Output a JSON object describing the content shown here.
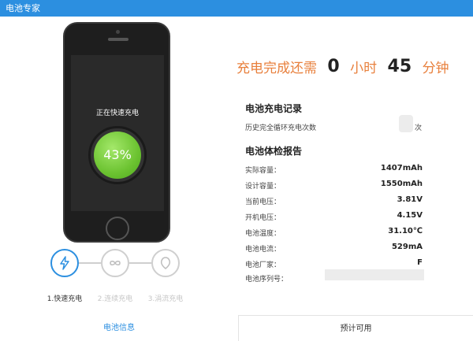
{
  "window": {
    "title": "电池专家"
  },
  "phone": {
    "charging_label": "正在快速充电",
    "battery_percent": "43%",
    "battery_level": 0.43
  },
  "modes": [
    {
      "label": "1.快速充电",
      "icon": "lightning-icon",
      "active": true
    },
    {
      "label": "2.连续充电",
      "icon": "infinity-icon",
      "active": false
    },
    {
      "label": "3.涓流充电",
      "icon": "droplet-icon",
      "active": false
    }
  ],
  "eta": {
    "prefix": "充电完成还需",
    "hours": "0",
    "hours_unit": "小时",
    "minutes": "45",
    "minutes_unit": "分钟"
  },
  "record": {
    "title": "电池充电记录",
    "cycle_label": "历史完全循环充电次数",
    "cycle_suffix": "次"
  },
  "report": {
    "title": "电池体检报告",
    "rows": [
      {
        "label": "实际容量：",
        "value": "1407mAh"
      },
      {
        "label": "设计容量：",
        "value": "1550mAh"
      },
      {
        "label": "当前电压：",
        "value": "3.81V"
      },
      {
        "label": "开机电压：",
        "value": "4.15V"
      },
      {
        "label": "电池温度：",
        "value": "31.10℃"
      },
      {
        "label": "电池电流：",
        "value": "529mA"
      },
      {
        "label": "电池厂家：",
        "value": "F"
      },
      {
        "label": "电池序列号：",
        "value": ""
      }
    ]
  },
  "footer": {
    "left": "电池信息",
    "right": "预计可用"
  },
  "colors": {
    "accent": "#2c8fe0",
    "eta": "#e8803d",
    "battery_green": "#6cc331"
  }
}
